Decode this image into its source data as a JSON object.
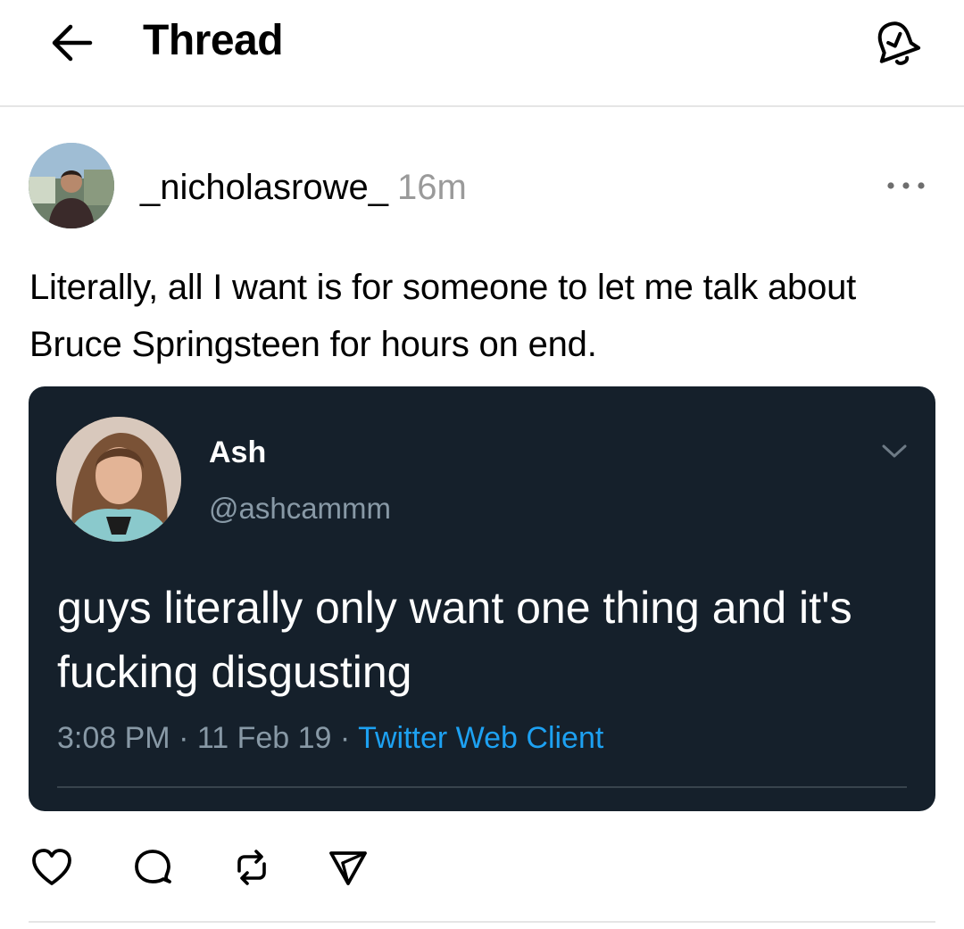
{
  "header": {
    "title": "Thread",
    "back_icon": "arrow-left-icon",
    "notify_icon": "bell-check-icon"
  },
  "post": {
    "username": "_nicholasrowe_",
    "time_ago": "16m",
    "text": "Literally, all I want is for someone to let me talk about Bruce Springsteen for hours on end.",
    "more_icon": "more-horizontal-icon"
  },
  "embedded_tweet": {
    "name": "Ash",
    "handle": "@ashcammm",
    "text": "guys literally only want one thing and it's fucking disgusting",
    "time": "3:08 PM",
    "date": "11 Feb 19",
    "separator": "·",
    "source": "Twitter Web Client",
    "background_color": "#15202b",
    "source_color": "#1da1f2"
  },
  "actions": [
    {
      "name": "like",
      "icon": "heart-icon"
    },
    {
      "name": "reply",
      "icon": "comment-icon"
    },
    {
      "name": "repost",
      "icon": "repost-icon"
    },
    {
      "name": "share",
      "icon": "send-icon"
    }
  ]
}
